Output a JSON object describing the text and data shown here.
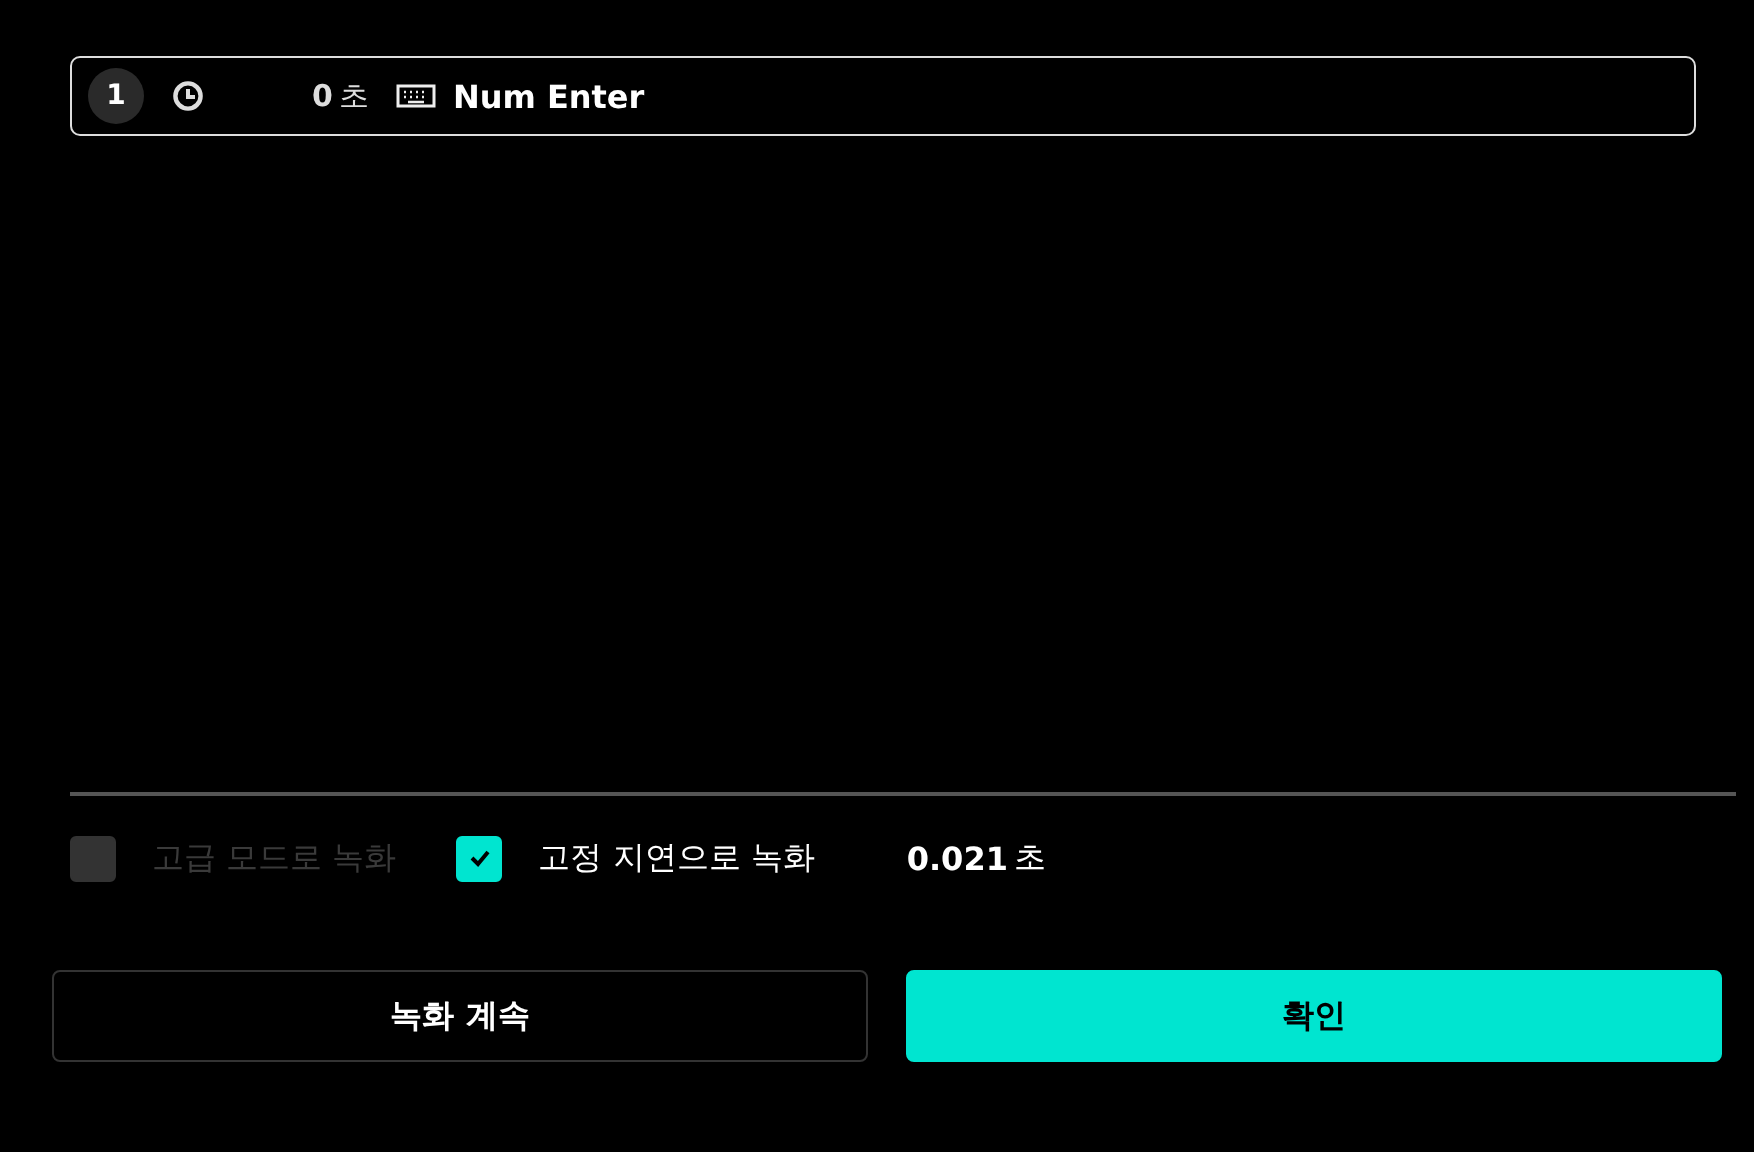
{
  "steps": [
    {
      "index": "1",
      "delay": "0",
      "delay_unit": "초",
      "key": "Num Enter"
    }
  ],
  "options": [
    {
      "label": "고급 모드로 녹화",
      "checked": false,
      "disabled": true
    },
    {
      "label": "고정 지연으로 녹화",
      "checked": true,
      "disabled": false
    }
  ],
  "delay": {
    "value": "0.021",
    "unit": "초"
  },
  "buttons": [
    {
      "label": "녹화 계속",
      "kind": "secondary"
    },
    {
      "label": "확인",
      "kind": "primary"
    }
  ]
}
